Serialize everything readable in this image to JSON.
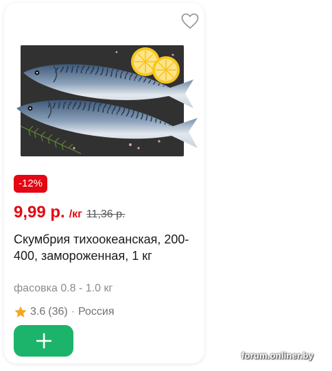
{
  "product": {
    "discount_badge": "-12%",
    "price_current": "9,99 р.",
    "price_unit": "/кг",
    "price_old": "11,36 р.",
    "title": "Скумбрия тихоокеанская, 200-400, замороженная, 1 кг",
    "pack_info": "фасовка 0.8 - 1.0 кг",
    "rating": "3.6",
    "reviews_count": "(36)",
    "country": "Россия",
    "image_icon": "mackerel-fish-photo",
    "favorite_icon": "heart-outline-icon",
    "star_icon": "star-icon",
    "add_icon": "plus-icon"
  },
  "watermark": {
    "text": "forum.onliner.by"
  },
  "colors": {
    "accent_red": "#e30613",
    "add_button_green": "#1cb36b",
    "star_orange": "#f5a623",
    "text_dark": "#1a1a1a",
    "text_muted": "#8a8a8a"
  }
}
